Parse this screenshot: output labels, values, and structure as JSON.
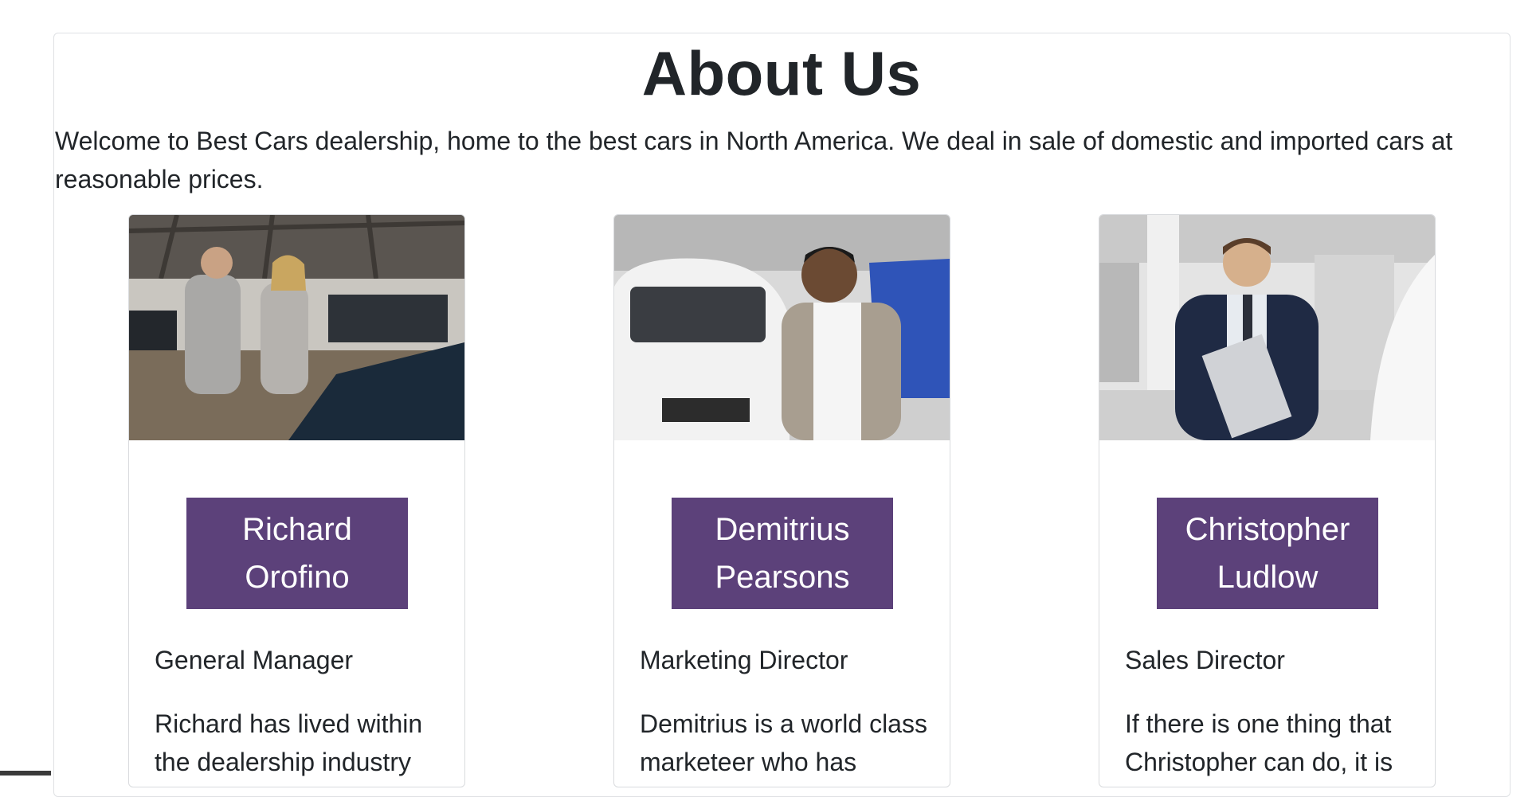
{
  "page": {
    "title": "About Us",
    "intro": "Welcome to Best Cars dealership, home to the best cars in North America. We deal in sale of domestic and imported cars at reasonable prices."
  },
  "team": [
    {
      "name": "Richard Orofino",
      "role": "General Manager",
      "bio": "Richard has lived within the dealership industry",
      "photo_icon": "showroom-photo"
    },
    {
      "name": "Demitrius Pearsons",
      "role": "Marketing Director",
      "bio": "Demitrius is a world class marketeer who has",
      "photo_icon": "showroom-photo"
    },
    {
      "name": "Christopher Ludlow",
      "role": "Sales Director",
      "bio": "If there is one thing that Christopher can do, it is",
      "photo_icon": "showroom-photo"
    }
  ],
  "colors": {
    "name_button_bg": "#5c417a",
    "name_button_text": "#ffffff",
    "text": "#212529",
    "border": "#dfe1e4"
  }
}
